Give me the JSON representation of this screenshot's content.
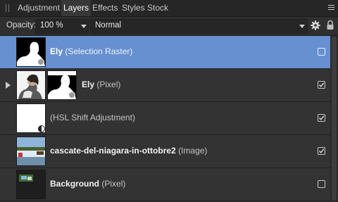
{
  "tabs": [
    {
      "label": "Adjustment",
      "active": false
    },
    {
      "label": "Layers",
      "active": true
    },
    {
      "label": "Effects",
      "active": false
    },
    {
      "label": "Styles",
      "active": false
    },
    {
      "label": "Stock",
      "active": false
    }
  ],
  "panel_menu_icon": "hamburger-icon",
  "toolbar": {
    "opacity_label": "Opacity:",
    "opacity_value": "100 %",
    "blend_mode": "Normal",
    "settings_icon": "gear-icon",
    "lock_icon": "lock-icon"
  },
  "layers": [
    {
      "name": "Ely",
      "type": "(Selection Raster)",
      "visible": false,
      "selected": true
    },
    {
      "name": "Ely",
      "type": "(Pixel)",
      "visible": true,
      "selected": false,
      "expandable": true
    },
    {
      "name": "",
      "type": "(HSL Shift Adjustment)",
      "visible": true,
      "selected": false
    },
    {
      "name": "cascate-del-niagara-in-ottobre2",
      "type": "(Image)",
      "visible": true,
      "selected": false
    },
    {
      "name": "Background",
      "type": "(Pixel)",
      "visible": false,
      "selected": false
    }
  ],
  "colors": {
    "panel_bg": "#303030",
    "selection": "#6690d0",
    "tabbar_bg": "#262626"
  }
}
